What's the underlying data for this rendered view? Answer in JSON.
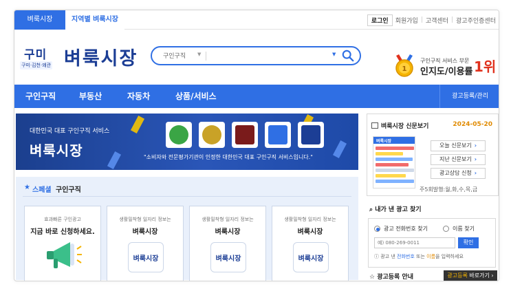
{
  "topbar": {
    "tabs": [
      "벼룩시장",
      "지역별 벼룩시장"
    ],
    "utility": [
      "로그인",
      "회원가입",
      "고객센터",
      "광고주인증센터"
    ]
  },
  "header": {
    "logo_region": "구미",
    "logo_sub": "구미·김천·왜관",
    "logo_title": "벼룩시장",
    "search": {
      "category": "구인구직",
      "placeholder": ""
    },
    "award_line1": "구인구직 서비스 부문",
    "award_line2": "인지도/이용률",
    "award_rank": "1위"
  },
  "nav": {
    "items": [
      "구인구직",
      "부동산",
      "자동차",
      "상품/서비스"
    ],
    "ad_link": "광고등록/관리"
  },
  "banner": {
    "small": "대한민국 대표 구인구직 서비스",
    "big": "벼룩시장",
    "caption": "\"소비자와 전문평가기관이 인정한 대한민국 대표 구인구직 서비스입니다.\"",
    "colors": [
      "#2f6fe4",
      "#1b3f8e",
      "#f5c400"
    ]
  },
  "special": {
    "label": "스페셜",
    "label2": "구인구직",
    "cards": [
      {
        "line1": "효과빠른 구인광고",
        "line2": "지금 바로 신청하세요."
      },
      {
        "line1": "생활밀착형 일자리 정보는",
        "line2": "벼룩시장",
        "mini": "벼룩시장"
      },
      {
        "line1": "생활밀착형 일자리 정보는",
        "line2": "벼룩시장",
        "mini": "벼룩시장"
      },
      {
        "line1": "생활밀착형 일자리 정보는",
        "line2": "벼룩시장",
        "mini": "벼룩시장"
      }
    ]
  },
  "newspaper": {
    "title": "벼룩시장 신문보기",
    "date": "2024-05-20",
    "paper_title": "벼룩시장",
    "buttons": [
      "오늘 신문보기",
      "지난 신문보기",
      "광고상담 신청"
    ],
    "note": "주5회발행:월,화,수,목,금"
  },
  "myad": {
    "title": "내가 낸 광고 찾기",
    "option1": "광고 전화번호 찾기",
    "option2": "이름 찾기",
    "input_placeholder": "예) 080-269-0011",
    "button": "확인",
    "note_pre": "광고 낸 ",
    "note_phone": "전화번호",
    "note_mid": " 또는 ",
    "note_name": "이름",
    "note_post": "을 입력하세요"
  },
  "adguide": {
    "title": "광고등록 안내",
    "btn_highlight": "광고등록",
    "btn_rest": " 바로가기 ›"
  }
}
